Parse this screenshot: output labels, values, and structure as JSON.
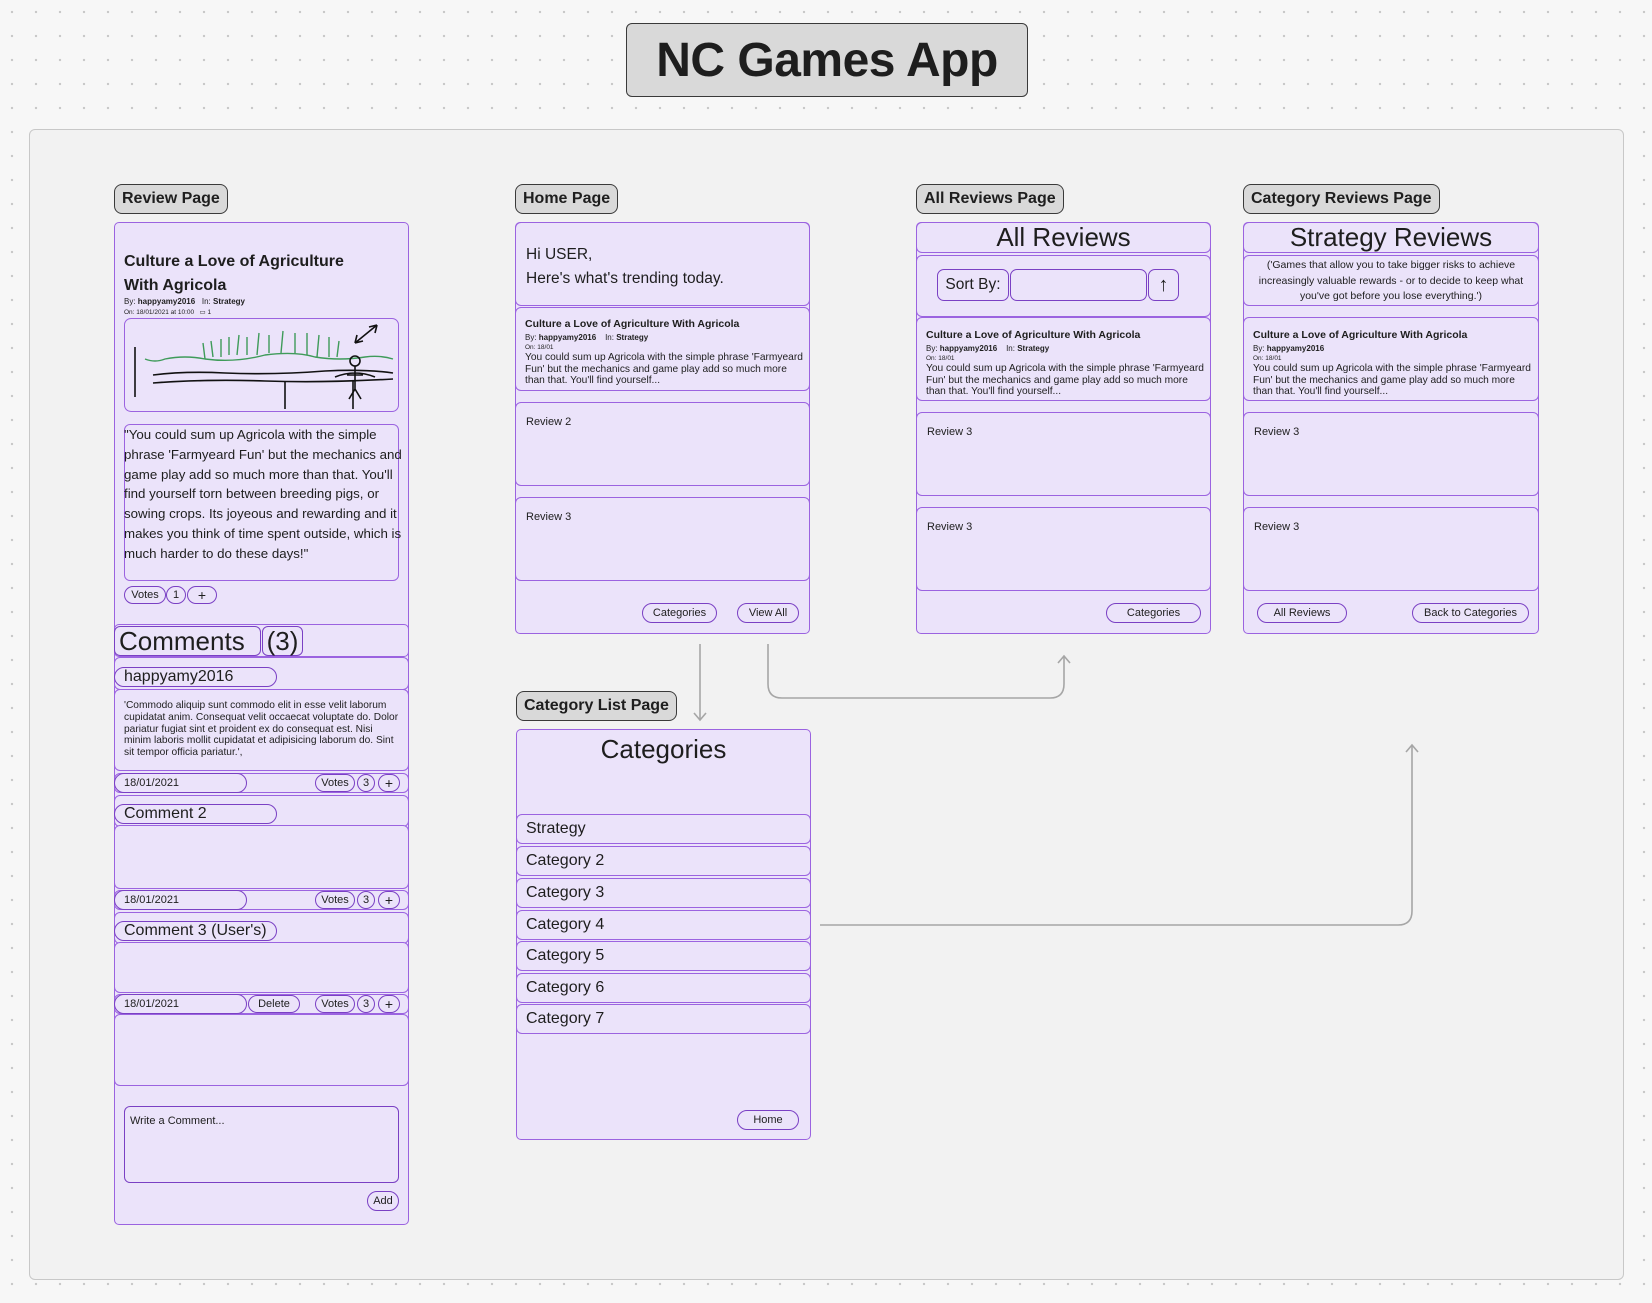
{
  "app_title": "NC Games App",
  "labels": {
    "review_page": "Review Page",
    "home_page": "Home Page",
    "all_reviews_page": "All Reviews Page",
    "category_reviews_page": "Category Reviews Page",
    "category_list_page": "Category List Page"
  },
  "review_page": {
    "title_line1": "Culture a Love of Agriculture",
    "title_line2": "With Agricola",
    "by_prefix": "By:",
    "author": "happyamy2016",
    "in_prefix": "In:",
    "category": "Strategy",
    "date_line": "On: 18/01/2021 at 10:00",
    "comment_count_icon": "1",
    "body": "\"You could sum up Agricola with the simple phrase 'Farmyeard Fun' but the mechanics and game play add so much more than that. You'll find yourself torn between breeding pigs, or sowing crops. Its joyeous and rewarding and it makes you think of time spent outside, which is much harder to do these days!\"",
    "votes_label": "Votes",
    "votes_count": "1",
    "plus": "+",
    "comments_heading": "Comments",
    "comments_count": "(3)",
    "comments": [
      {
        "author": "happyamy2016",
        "body": "'Commodo aliquip sunt commodo elit in esse velit laborum cupidatat anim. Consequat velit occaecat voluptate do. Dolor pariatur fugiat sint et proident ex do consequat est. Nisi minim laboris mollit cupidatat et adipisicing laborum do. Sint sit tempor officia pariatur.',",
        "date": "18/01/2021",
        "votes_label": "Votes",
        "votes": "3",
        "plus": "+"
      },
      {
        "author": "Comment 2",
        "body": "",
        "date": "18/01/2021",
        "votes_label": "Votes",
        "votes": "3",
        "plus": "+"
      },
      {
        "author": "Comment 3 (User's)",
        "body": "",
        "date": "18/01/2021",
        "delete": "Delete",
        "votes_label": "Votes",
        "votes": "3",
        "plus": "+"
      }
    ],
    "comment_placeholder": "Write a Comment...",
    "add_button": "Add"
  },
  "home_page": {
    "greeting_line1": "Hi USER,",
    "greeting_line2": "Here's what's trending today.",
    "card_title": "Culture a Love of Agriculture With Agricola",
    "card_by_prefix": "By:",
    "card_author": "happyamy2016",
    "card_in_prefix": "In:",
    "card_category": "Strategy",
    "card_date": "On: 18/01",
    "card_excerpt": "You could sum up Agricola with the simple phrase 'Farmyeard Fun' but the mechanics and game play add so much more than that. You'll find yourself...",
    "review2": "Review 2",
    "review3": "Review 3",
    "categories_button": "Categories",
    "view_all_button": "View All"
  },
  "all_reviews_page": {
    "heading": "All Reviews",
    "sort_by": "Sort By:",
    "sort_arrow": "↑",
    "card_title": "Culture a Love of Agriculture With Agricola",
    "card_by_prefix": "By:",
    "card_author": "happyamy2016",
    "card_in_prefix": "In:",
    "card_category": "Strategy",
    "card_date": "On: 18/01",
    "card_excerpt": "You could sum up Agricola with the simple phrase 'Farmyeard Fun' but the mechanics and game play add so much more than that. You'll find yourself...",
    "review_a": "Review 3",
    "review_b": "Review 3",
    "categories_button": "Categories"
  },
  "category_reviews_page": {
    "heading": "Strategy Reviews",
    "description": "('Games that allow you to take bigger risks to achieve increasingly valuable rewards - or to decide to keep what you've got before you lose everything.')",
    "card_title": "Culture a Love of Agriculture With Agricola",
    "card_by_prefix": "By:",
    "card_author": "happyamy2016",
    "card_date": "On: 18/01",
    "card_excerpt": "You could sum up Agricola with the simple phrase 'Farmyeard Fun' but the mechanics and game play add so much more than that. You'll find yourself...",
    "review_a": "Review 3",
    "review_b": "Review 3",
    "all_reviews_button": "All Reviews",
    "back_button": "Back to Categories"
  },
  "category_list_page": {
    "heading": "Categories",
    "items": [
      "Strategy",
      "Category 2",
      "Category 3",
      "Category 4",
      "Category 5",
      "Category 6",
      "Category 7"
    ],
    "home_button": "Home"
  },
  "colors": {
    "frame_fill": "#ebe3fa",
    "frame_border": "#9b63e0",
    "label_fill": "#d9d9d9",
    "connector": "#a6a6a6",
    "sketch_green": "#3f9b5a"
  }
}
